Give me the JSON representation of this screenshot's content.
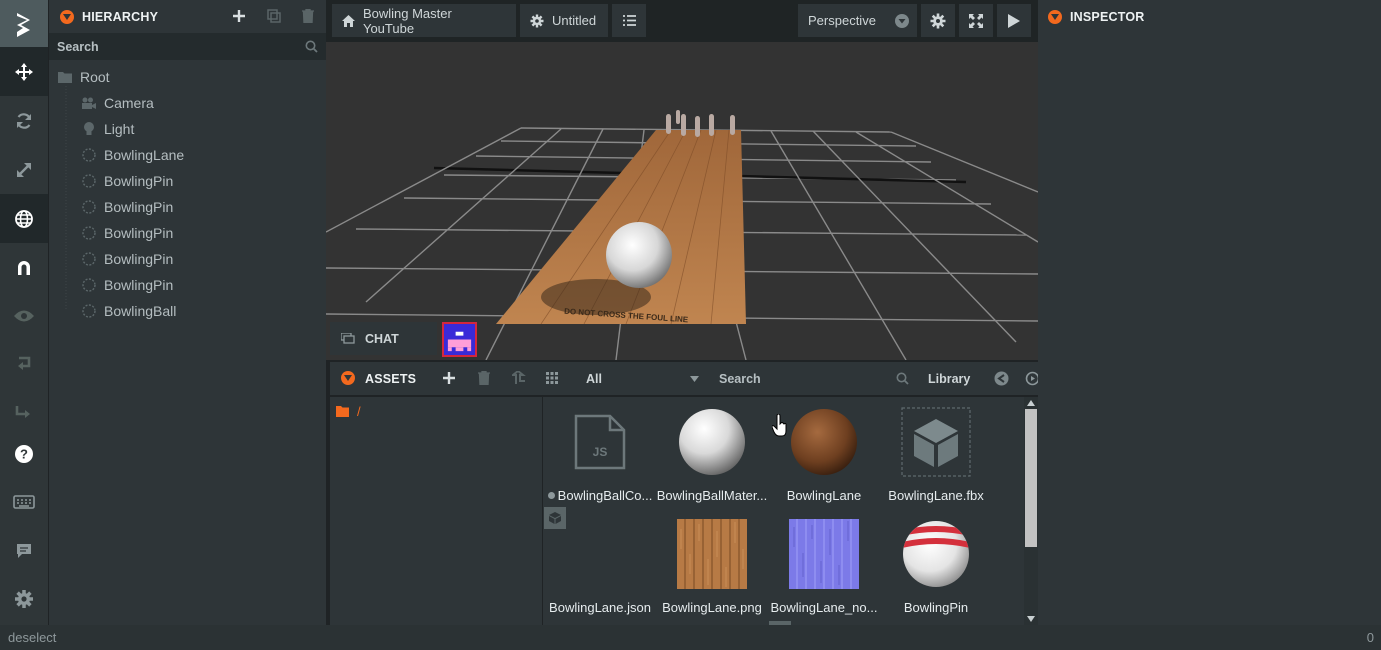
{
  "hierarchy": {
    "title": "HIERARCHY",
    "search_placeholder": "Search",
    "root": "Root",
    "items": [
      {
        "label": "Camera",
        "icon": "camera-icon"
      },
      {
        "label": "Light",
        "icon": "bulb-icon"
      },
      {
        "label": "BowlingLane",
        "icon": "entity-icon"
      },
      {
        "label": "BowlingPin",
        "icon": "entity-icon"
      },
      {
        "label": "BowlingPin",
        "icon": "entity-icon"
      },
      {
        "label": "BowlingPin",
        "icon": "entity-icon"
      },
      {
        "label": "BowlingPin",
        "icon": "entity-icon"
      },
      {
        "label": "BowlingPin",
        "icon": "entity-icon"
      },
      {
        "label": "BowlingBall",
        "icon": "entity-icon"
      }
    ]
  },
  "topbar": {
    "project": "Bowling Master YouTube",
    "scene": "Untitled",
    "camera_mode": "Perspective"
  },
  "chat": {
    "label": "CHAT"
  },
  "assets": {
    "title": "ASSETS",
    "filter": "All",
    "search_placeholder": "Search",
    "library": "Library",
    "folder": "/",
    "items": [
      {
        "label": "BowlingBallCo...",
        "type": "script"
      },
      {
        "label": "BowlingBallMater...",
        "type": "material"
      },
      {
        "label": "BowlingLane",
        "type": "material"
      },
      {
        "label": "BowlingLane.fbx",
        "type": "model"
      },
      {
        "label": "BowlingLane.json",
        "type": "json"
      },
      {
        "label": "BowlingLane.png",
        "type": "texture"
      },
      {
        "label": "BowlingLane_no...",
        "type": "texture"
      },
      {
        "label": "BowlingPin",
        "type": "material"
      }
    ]
  },
  "inspector": {
    "title": "INSPECTOR"
  },
  "status": {
    "text": "deselect",
    "count": "0"
  },
  "colors": {
    "accent": "#f3691e",
    "panel": "#2e3538",
    "toolbar": "#2f3638"
  }
}
